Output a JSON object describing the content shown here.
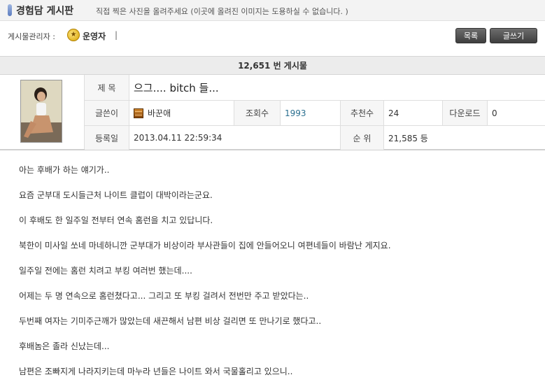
{
  "board": {
    "title": "경험담 게시판",
    "notice": "직접 찍은 사진을 올려주세요 (이곳에 올려진 이미지는 도용하실 수 없습니다. )"
  },
  "admin": {
    "label": "게시물관리자 :",
    "icon": "medal-icon",
    "name": "운영자",
    "separator": "|"
  },
  "toolbar": {
    "list_label": "목록",
    "write_label": "글쓰기"
  },
  "post_count": "12,651 번 게시물",
  "post": {
    "subject_label": "제  목",
    "subject": "으그.... bitch 들...",
    "author_label": "글쓴이",
    "author_icon": "level-icon",
    "author": "바꾼애",
    "views_label": "조회수",
    "views": "1993",
    "recommend_label": "추천수",
    "recommend": "24",
    "download_label": "다운로드",
    "download": "0",
    "date_label": "등록일",
    "date": "2013.04.11 22:59:34",
    "rank_label": "순  위",
    "rank": "21,585 등"
  },
  "body": [
    "아는 후배가 하는 얘기가..",
    "요즘 군부대 도시들근처 나이트 클럽이 대박이라는군요.",
    "이 후배도 한 일주일 전부터 연속 홈런을 치고 있답니다.",
    "북한이 미사일 쏘네 마네하니깐 군부대가 비상이라 부사관들이 집에 안들어오니 여편네들이 바람난 게지요.",
    "일주일 전에는 홈런 치려고 부킹 여러번 했는데....",
    "어제는 두 명 연속으로 홈런쳤다고... 그리고 또 부킹 걸려서 전번만 주고 받았다는..",
    "두번째 여자는 기미주근깨가 많았는데 새끈해서 남편 비상 걸리면 또 만나기로 했다고..",
    "후배놈은 졸라 신났는데...",
    "남편은 조빠지게 나라지키는데 마누라 년들은 나이트 와서 국물홀리고 있으니.."
  ],
  "colors": {
    "header_bg": "#f3f3f3",
    "button_bg": "#4a4a4a",
    "view_count": "#2a6f8f"
  }
}
